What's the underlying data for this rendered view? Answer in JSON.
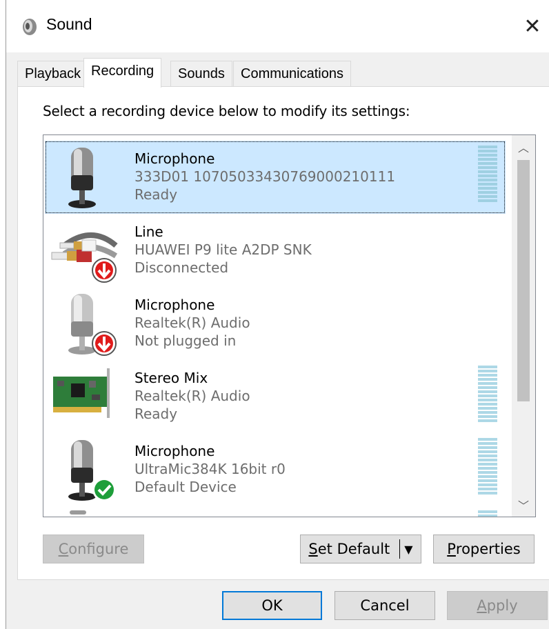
{
  "window": {
    "title": "Sound",
    "close_glyph": "✕"
  },
  "tabs": [
    {
      "label": "Playback",
      "active": false
    },
    {
      "label": "Recording",
      "active": true
    },
    {
      "label": "Sounds",
      "active": false
    },
    {
      "label": "Communications",
      "active": false
    }
  ],
  "instruction": "Select a recording device below to modify its settings:",
  "devices": [
    {
      "name": "Microphone",
      "description": "333D01 1070503343076900021011​1",
      "status": "Ready",
      "icon": "microphone-icon",
      "selected": true,
      "has_meter": true
    },
    {
      "name": "Line",
      "description": "HUAWEI P9 lite A2DP SNK",
      "status": "Disconnected",
      "icon": "line-in-cable-icon",
      "badge": "disconnected-arrow-icon",
      "has_meter": false
    },
    {
      "name": "Microphone",
      "description": "Realtek(R) Audio",
      "status": "Not plugged in",
      "icon": "microphone-icon",
      "badge": "disconnected-arrow-icon",
      "has_meter": false
    },
    {
      "name": "Stereo Mix",
      "description": "Realtek(R) Audio",
      "status": "Ready",
      "icon": "sound-card-icon",
      "has_meter": true
    },
    {
      "name": "Microphone",
      "description": "UltraMic384K 16bit r0",
      "status": "Default Device",
      "icon": "microphone-icon",
      "badge": "default-check-icon",
      "has_meter": true
    }
  ],
  "buttons": {
    "configure": "onfigure",
    "configure_mnemonic": "C",
    "set_default": "et Default",
    "set_default_mnemonic": "S",
    "properties": "roperties",
    "properties_mnemonic": "P",
    "ok": "OK",
    "cancel": "Cancel",
    "apply": "pply",
    "apply_mnemonic": "A"
  },
  "colors": {
    "selection": "#cce8ff",
    "accent": "#0078d7",
    "meter": "#add8e6"
  }
}
